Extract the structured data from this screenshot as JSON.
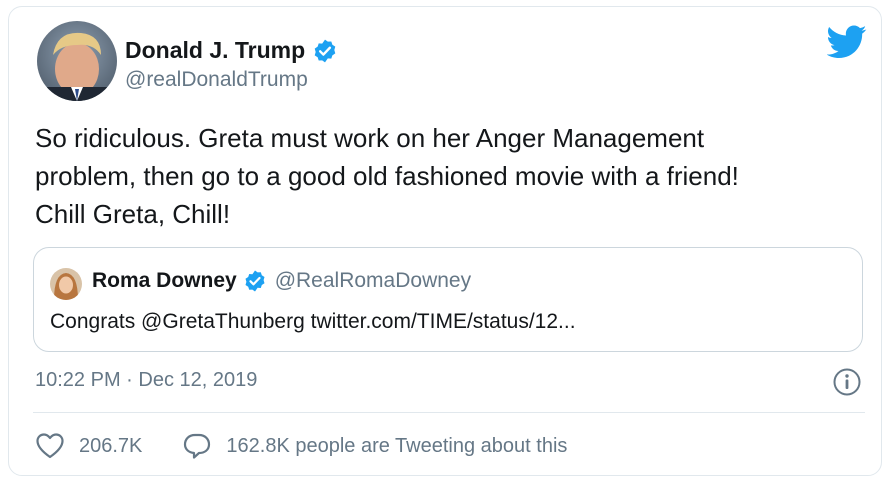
{
  "tweet": {
    "author_name": "Donald J. Trump",
    "author_handle": "@realDonaldTrump",
    "text": "So ridiculous. Greta must work on her Anger Management\nproblem, then go to a good old fashioned movie with a friend!\nChill Greta, Chill!",
    "time": "10:22 PM",
    "separator": " · ",
    "date": "Dec 12, 2019"
  },
  "quote": {
    "author_name": "Roma Downey",
    "author_handle": "@RealRomaDowney",
    "text": "Congrats @GretaThunberg twitter.com/TIME/status/12..."
  },
  "stats": {
    "likes": "206.7K",
    "replies_text": "162.8K people are Tweeting about this"
  },
  "icons": {
    "brand": "twitter-bird-icon",
    "verified": "verified-badge-icon",
    "info": "info-icon",
    "like": "heart-icon",
    "reply": "comment-bubble-icon"
  },
  "colors": {
    "twitter_blue": "#1da1f2",
    "text_primary": "#14171a",
    "text_secondary": "#657786",
    "border": "#e1e8ed"
  }
}
